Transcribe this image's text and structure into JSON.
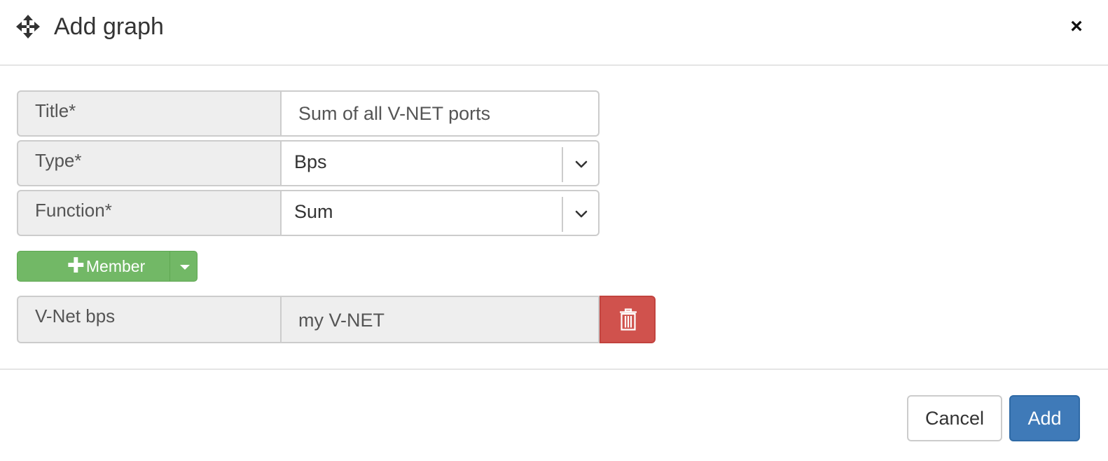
{
  "dialog": {
    "title": "Add graph",
    "move_icon": "move-icon",
    "close_label": "×"
  },
  "form": {
    "title": {
      "label": "Title*",
      "value": "Sum of all V-NET ports"
    },
    "type": {
      "label": "Type*",
      "selected": "Bps"
    },
    "function": {
      "label": "Function*",
      "selected": "Sum"
    }
  },
  "member_button": {
    "icon": "plus-icon",
    "label": "Member"
  },
  "members": [
    {
      "label": "V-Net bps",
      "value": "my V-NET",
      "delete_icon": "trash-icon"
    }
  ],
  "footer": {
    "cancel_label": "Cancel",
    "add_label": "Add"
  },
  "colors": {
    "member_button_green": "#72b866",
    "delete_red": "#d0524d",
    "add_blue": "#3f7ab8"
  }
}
